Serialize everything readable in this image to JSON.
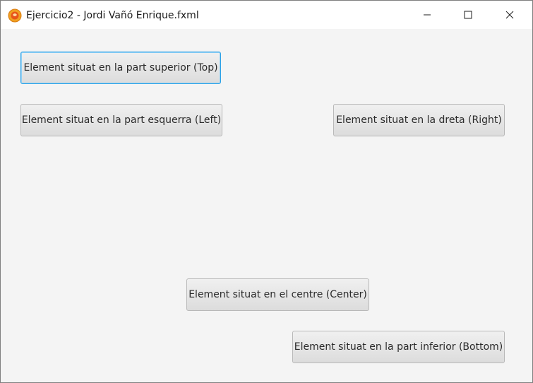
{
  "window": {
    "title": "Ejercicio2 - Jordi Vañó Enrique.fxml",
    "controls": {
      "minimize": "minimize-icon",
      "maximize": "maximize-icon",
      "close": "close-icon"
    },
    "app_icon": "java-app-icon"
  },
  "buttons": {
    "top": "Element situat en la part superior (Top)",
    "left": "Element situat en la part esquerra (Left)",
    "right": "Element situat en la dreta (Right)",
    "center": "Element situat en el centre (Center)",
    "bottom": "Element situat en la part inferior (Bottom)"
  },
  "colors": {
    "focus_border": "#2ba0e6",
    "app_icon_bg": "#f0a020"
  }
}
